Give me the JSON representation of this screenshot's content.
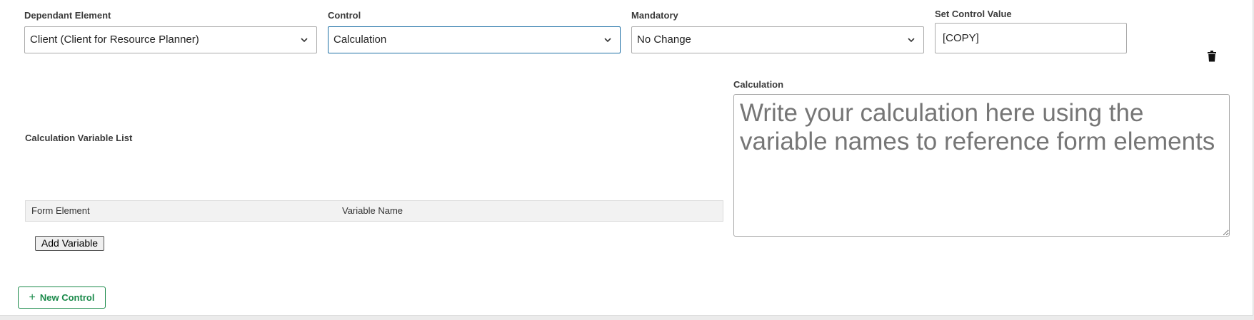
{
  "dependant_element": {
    "label": "Dependant Element",
    "value": "Client (Client for Resource Planner)"
  },
  "control": {
    "label": "Control",
    "value": "Calculation"
  },
  "mandatory": {
    "label": "Mandatory",
    "value": "No Change"
  },
  "set_control_value": {
    "label": "Set Control Value",
    "value": "[COPY]"
  },
  "calculation": {
    "label": "Calculation",
    "placeholder": "Write your calculation here using the variable names to reference form elements"
  },
  "variable_list": {
    "title": "Calculation Variable List",
    "columns": [
      "Form Element",
      "Variable Name"
    ],
    "add_button": "Add Variable"
  },
  "new_control_button": "New Control",
  "icons": {
    "dropdown": "chevron-down-icon",
    "delete": "trash-icon",
    "add": "plus-icon"
  },
  "colors": {
    "accent_green": "#1a8a4a",
    "focus_blue": "#1d6fa5"
  }
}
